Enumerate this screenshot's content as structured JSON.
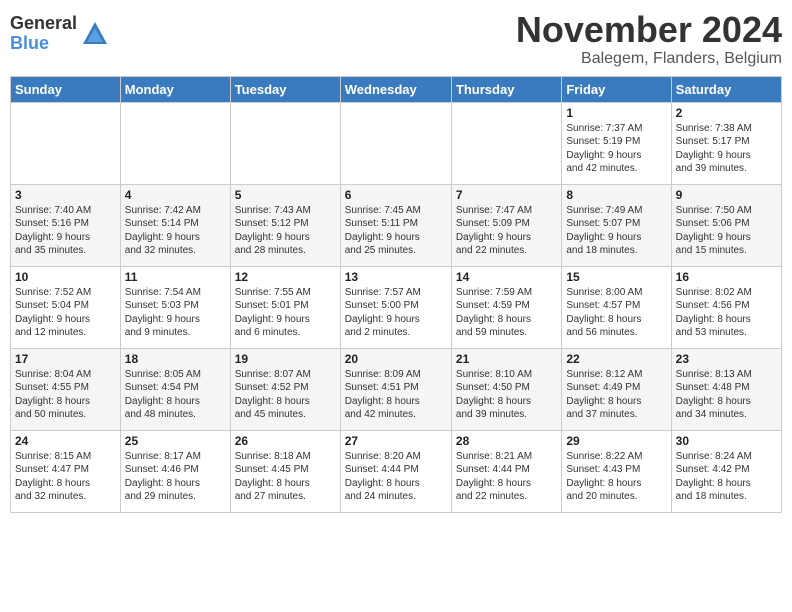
{
  "header": {
    "logo": {
      "general": "General",
      "blue": "Blue"
    },
    "title": "November 2024",
    "subtitle": "Balegem, Flanders, Belgium"
  },
  "weekdays": [
    "Sunday",
    "Monday",
    "Tuesday",
    "Wednesday",
    "Thursday",
    "Friday",
    "Saturday"
  ],
  "weeks": [
    [
      {
        "day": "",
        "info": ""
      },
      {
        "day": "",
        "info": ""
      },
      {
        "day": "",
        "info": ""
      },
      {
        "day": "",
        "info": ""
      },
      {
        "day": "",
        "info": ""
      },
      {
        "day": "1",
        "info": "Sunrise: 7:37 AM\nSunset: 5:19 PM\nDaylight: 9 hours\nand 42 minutes."
      },
      {
        "day": "2",
        "info": "Sunrise: 7:38 AM\nSunset: 5:17 PM\nDaylight: 9 hours\nand 39 minutes."
      }
    ],
    [
      {
        "day": "3",
        "info": "Sunrise: 7:40 AM\nSunset: 5:16 PM\nDaylight: 9 hours\nand 35 minutes."
      },
      {
        "day": "4",
        "info": "Sunrise: 7:42 AM\nSunset: 5:14 PM\nDaylight: 9 hours\nand 32 minutes."
      },
      {
        "day": "5",
        "info": "Sunrise: 7:43 AM\nSunset: 5:12 PM\nDaylight: 9 hours\nand 28 minutes."
      },
      {
        "day": "6",
        "info": "Sunrise: 7:45 AM\nSunset: 5:11 PM\nDaylight: 9 hours\nand 25 minutes."
      },
      {
        "day": "7",
        "info": "Sunrise: 7:47 AM\nSunset: 5:09 PM\nDaylight: 9 hours\nand 22 minutes."
      },
      {
        "day": "8",
        "info": "Sunrise: 7:49 AM\nSunset: 5:07 PM\nDaylight: 9 hours\nand 18 minutes."
      },
      {
        "day": "9",
        "info": "Sunrise: 7:50 AM\nSunset: 5:06 PM\nDaylight: 9 hours\nand 15 minutes."
      }
    ],
    [
      {
        "day": "10",
        "info": "Sunrise: 7:52 AM\nSunset: 5:04 PM\nDaylight: 9 hours\nand 12 minutes."
      },
      {
        "day": "11",
        "info": "Sunrise: 7:54 AM\nSunset: 5:03 PM\nDaylight: 9 hours\nand 9 minutes."
      },
      {
        "day": "12",
        "info": "Sunrise: 7:55 AM\nSunset: 5:01 PM\nDaylight: 9 hours\nand 6 minutes."
      },
      {
        "day": "13",
        "info": "Sunrise: 7:57 AM\nSunset: 5:00 PM\nDaylight: 9 hours\nand 2 minutes."
      },
      {
        "day": "14",
        "info": "Sunrise: 7:59 AM\nSunset: 4:59 PM\nDaylight: 8 hours\nand 59 minutes."
      },
      {
        "day": "15",
        "info": "Sunrise: 8:00 AM\nSunset: 4:57 PM\nDaylight: 8 hours\nand 56 minutes."
      },
      {
        "day": "16",
        "info": "Sunrise: 8:02 AM\nSunset: 4:56 PM\nDaylight: 8 hours\nand 53 minutes."
      }
    ],
    [
      {
        "day": "17",
        "info": "Sunrise: 8:04 AM\nSunset: 4:55 PM\nDaylight: 8 hours\nand 50 minutes."
      },
      {
        "day": "18",
        "info": "Sunrise: 8:05 AM\nSunset: 4:54 PM\nDaylight: 8 hours\nand 48 minutes."
      },
      {
        "day": "19",
        "info": "Sunrise: 8:07 AM\nSunset: 4:52 PM\nDaylight: 8 hours\nand 45 minutes."
      },
      {
        "day": "20",
        "info": "Sunrise: 8:09 AM\nSunset: 4:51 PM\nDaylight: 8 hours\nand 42 minutes."
      },
      {
        "day": "21",
        "info": "Sunrise: 8:10 AM\nSunset: 4:50 PM\nDaylight: 8 hours\nand 39 minutes."
      },
      {
        "day": "22",
        "info": "Sunrise: 8:12 AM\nSunset: 4:49 PM\nDaylight: 8 hours\nand 37 minutes."
      },
      {
        "day": "23",
        "info": "Sunrise: 8:13 AM\nSunset: 4:48 PM\nDaylight: 8 hours\nand 34 minutes."
      }
    ],
    [
      {
        "day": "24",
        "info": "Sunrise: 8:15 AM\nSunset: 4:47 PM\nDaylight: 8 hours\nand 32 minutes."
      },
      {
        "day": "25",
        "info": "Sunrise: 8:17 AM\nSunset: 4:46 PM\nDaylight: 8 hours\nand 29 minutes."
      },
      {
        "day": "26",
        "info": "Sunrise: 8:18 AM\nSunset: 4:45 PM\nDaylight: 8 hours\nand 27 minutes."
      },
      {
        "day": "27",
        "info": "Sunrise: 8:20 AM\nSunset: 4:44 PM\nDaylight: 8 hours\nand 24 minutes."
      },
      {
        "day": "28",
        "info": "Sunrise: 8:21 AM\nSunset: 4:44 PM\nDaylight: 8 hours\nand 22 minutes."
      },
      {
        "day": "29",
        "info": "Sunrise: 8:22 AM\nSunset: 4:43 PM\nDaylight: 8 hours\nand 20 minutes."
      },
      {
        "day": "30",
        "info": "Sunrise: 8:24 AM\nSunset: 4:42 PM\nDaylight: 8 hours\nand 18 minutes."
      }
    ]
  ]
}
